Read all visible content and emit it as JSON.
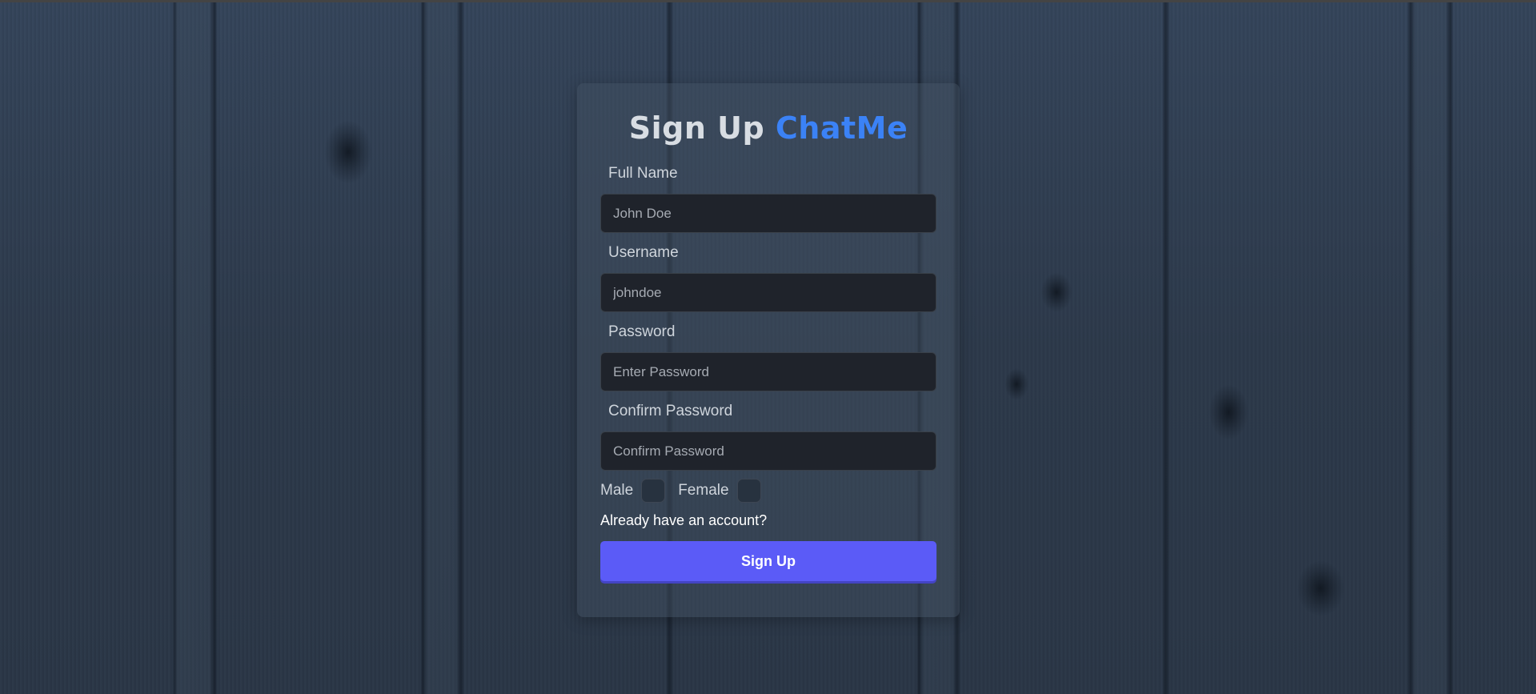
{
  "form": {
    "title": "Sign Up",
    "brand": "ChatMe",
    "fields": [
      {
        "label": "Full Name",
        "placeholder": "John Doe"
      },
      {
        "label": "Username",
        "placeholder": "johndoe"
      },
      {
        "label": "Password",
        "placeholder": "Enter Password"
      },
      {
        "label": "Confirm Password",
        "placeholder": "Confirm Password"
      }
    ],
    "gender": {
      "male_label": "Male",
      "female_label": "Female"
    },
    "login_link": "Already have an account?",
    "submit_label": "Sign Up"
  },
  "colors": {
    "brand": "#3b82f6",
    "button": "#5b5bf7",
    "input_bg": "#1f232b"
  }
}
